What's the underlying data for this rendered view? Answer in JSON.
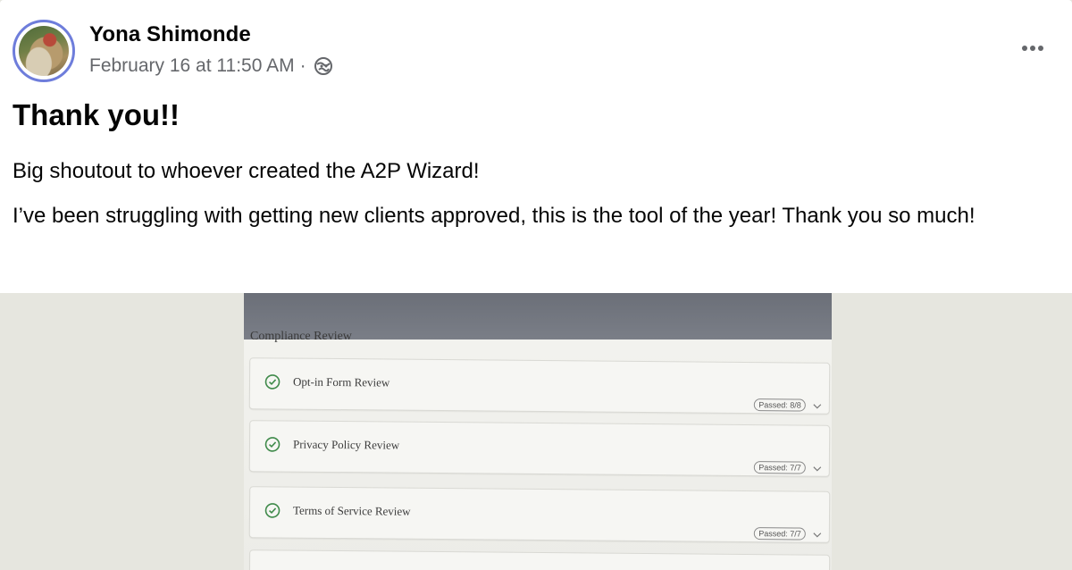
{
  "post": {
    "author": "Yona Shimonde",
    "timestamp": "February 16 at 11:50 AM",
    "separator": "·",
    "audience_icon": "globe-icon",
    "more_icon": "more-options-icon",
    "title": "Thank you!!",
    "paragraphs": [
      "Big shoutout to whoever created the A2P Wizard!",
      "I’ve been struggling with getting new clients approved, this is the tool of the year! Thank you so much!"
    ]
  },
  "photo": {
    "section_title": "Compliance Review",
    "reviews": [
      {
        "label": "Opt-in Form Review",
        "status": "Passed: 8/8",
        "icon": "check-circle-icon"
      },
      {
        "label": "Privacy Policy Review",
        "status": "Passed: 7/7",
        "icon": "check-circle-icon"
      },
      {
        "label": "Terms of Service Review",
        "status": "Passed: 7/7",
        "icon": "check-circle-icon"
      }
    ]
  },
  "colors": {
    "text_primary": "#050505",
    "text_secondary": "#65676b",
    "avatar_ring": "#6e7ddb",
    "check_green": "#3f8a4a"
  }
}
